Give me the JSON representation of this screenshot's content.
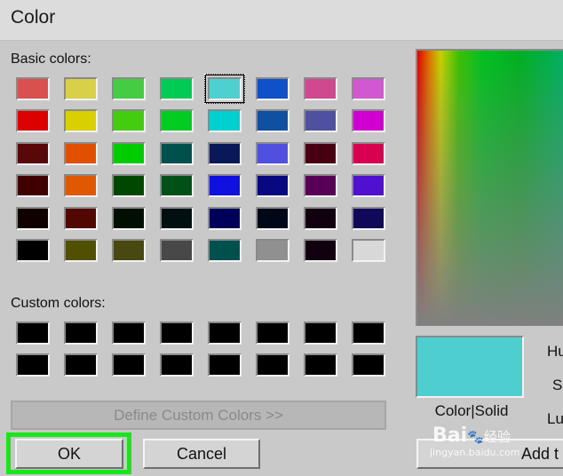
{
  "window": {
    "title": "Color"
  },
  "labels": {
    "basic_colors": "Basic colors:",
    "custom_colors": "Custom colors:",
    "preview": "Color|Solid",
    "hue": "Hu",
    "sat": "S",
    "lum": "Lu"
  },
  "buttons": {
    "define_custom": "Define Custom Colors >>",
    "ok": "OK",
    "cancel": "Cancel",
    "add_custom": "Add t"
  },
  "basic_colors": [
    [
      "#d9514e",
      "#d8d048",
      "#44cc44",
      "#00cc55",
      "#4fd0d0",
      "#1050c8",
      "#d04890",
      "#d058d0"
    ],
    [
      "#dd0000",
      "#d8d000",
      "#44cc10",
      "#00cc22",
      "#00d0d0",
      "#1050a0",
      "#5050a0",
      "#d000d0"
    ],
    [
      "#580808",
      "#e05000",
      "#00cc00",
      "#005050",
      "#081858",
      "#5050e0",
      "#480010",
      "#d80050"
    ],
    [
      "#400000",
      "#e05800",
      "#004800",
      "#005018",
      "#1010e0",
      "#080880",
      "#580058",
      "#5010d0"
    ],
    [
      "#100000",
      "#500800",
      "#001000",
      "#001010",
      "#000058",
      "#000818",
      "#100010",
      "#100858"
    ],
    [
      "#000000",
      "#505000",
      "#484810",
      "#484848",
      "#005050",
      "#909090",
      "#100010",
      "#d8d8d8"
    ]
  ],
  "selected_basic": {
    "row": 0,
    "col": 4
  },
  "custom_colors": [
    [
      "#000000",
      "#000000",
      "#000000",
      "#000000",
      "#000000",
      "#000000",
      "#000000",
      "#000000"
    ],
    [
      "#000000",
      "#000000",
      "#000000",
      "#000000",
      "#000000",
      "#000000",
      "#000000",
      "#000000"
    ]
  ],
  "current_color": "#4ecece",
  "watermark": {
    "brand": "Bai",
    "cn": "经验",
    "url": "jingyan.baidu.com"
  }
}
